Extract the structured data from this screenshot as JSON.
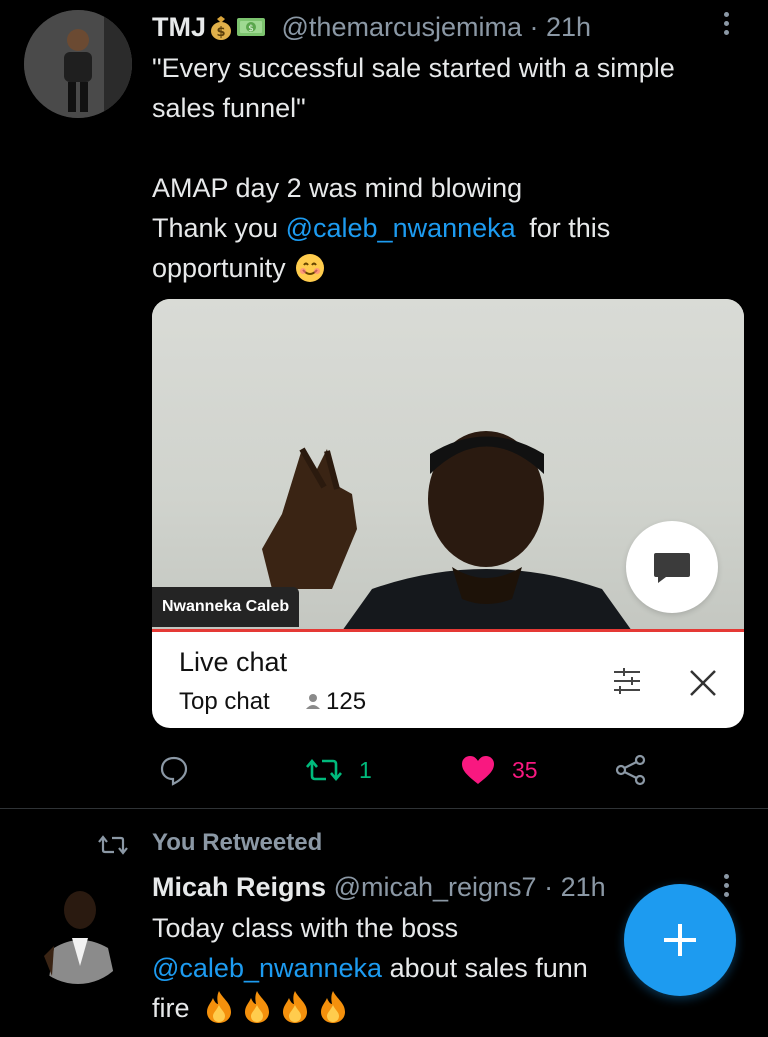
{
  "tweet1": {
    "display_name": "TMJ",
    "name_emojis": [
      "money-bag-icon",
      "dollar-banknote-icon"
    ],
    "handle": "@themarcusjemima",
    "separator": "·",
    "time": "21h",
    "text_line1": "\"Every successful sale started with a simple",
    "text_line2": "sales funnel\"",
    "text_line3": "AMAP day 2 was mind blowing",
    "text_thank": "Thank you",
    "mention": "@caleb_nwanneka",
    "text_for_this": "for this",
    "text_line5": "opportunity",
    "media": {
      "speaker_name": "Nwanneka Caleb",
      "live_chat_title": "Live chat",
      "top_chat_label": "Top chat",
      "viewer_count": "125"
    },
    "actions": {
      "retweets": "1",
      "likes": "35"
    }
  },
  "retweet_banner": "You Retweeted",
  "tweet2": {
    "display_name": "Micah Reigns",
    "handle": "@micah_reigns7",
    "separator": "·",
    "time": "21h",
    "text_line1": "Today class with the boss",
    "mention": "@caleb_nwanneka",
    "text_after_mention": "about sales funn",
    "text_line3": "fire",
    "fire_emoji_count": 4
  },
  "colors": {
    "background": "#000000",
    "text": "#e7e9ea",
    "muted": "#8b98a5",
    "link": "#1d9bf0",
    "retweet_green": "#00ba7c",
    "like_pink": "#f91880",
    "divider": "#2f3336"
  }
}
